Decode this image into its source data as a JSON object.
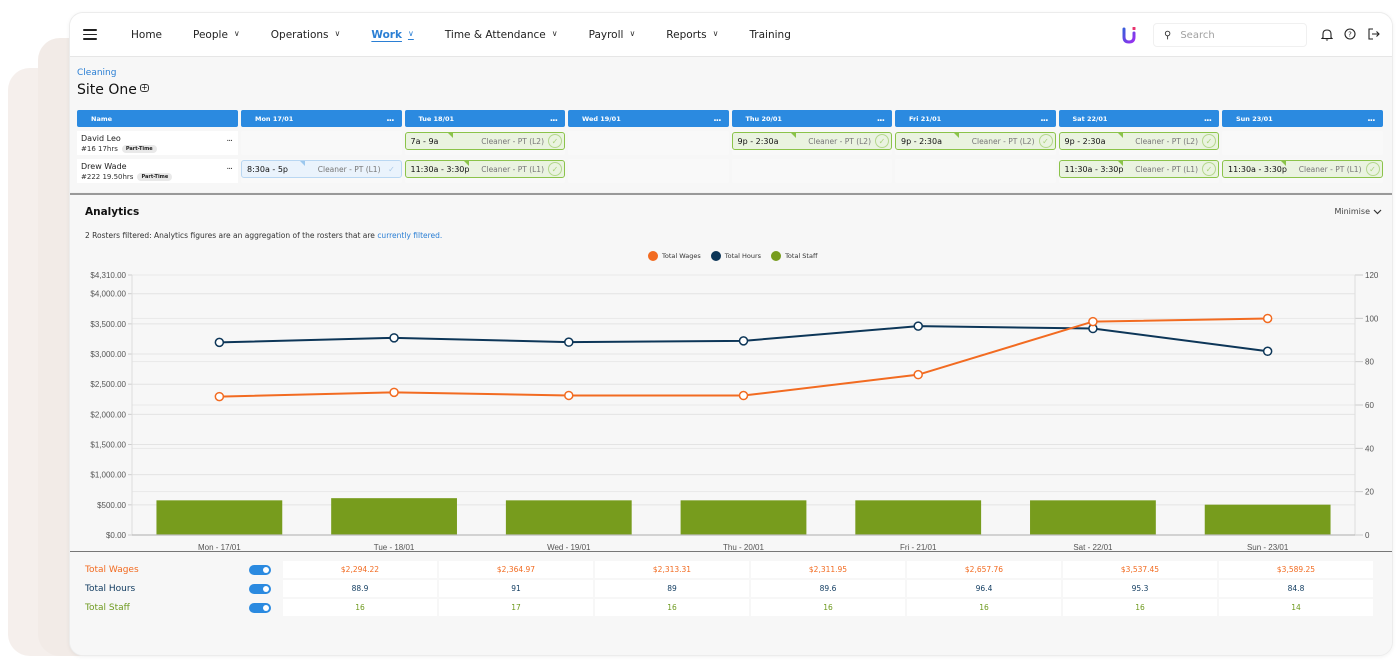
{
  "nav": {
    "items": [
      {
        "label": "Home",
        "dropdown": false,
        "active": false
      },
      {
        "label": "People",
        "dropdown": true,
        "active": false
      },
      {
        "label": "Operations",
        "dropdown": true,
        "active": false
      },
      {
        "label": "Work",
        "dropdown": true,
        "active": true
      },
      {
        "label": "Time & Attendance",
        "dropdown": true,
        "active": false
      },
      {
        "label": "Payroll",
        "dropdown": true,
        "active": false
      },
      {
        "label": "Reports",
        "dropdown": true,
        "active": false
      },
      {
        "label": "Training",
        "dropdown": false,
        "active": false
      }
    ],
    "search_placeholder": "Search",
    "icons": [
      "bell-icon",
      "help-icon",
      "logout-icon"
    ]
  },
  "roster": {
    "breadcrumb": "Cleaning",
    "title": "Site One",
    "name_header": "Name",
    "more_label": "...",
    "days": [
      "Mon 17/01",
      "Tue 18/01",
      "Wed 19/01",
      "Thu 20/01",
      "Fri 21/01",
      "Sat 22/01",
      "Sun 23/01"
    ],
    "employees": [
      {
        "name": "David Leo",
        "meta": "#16  17hrs",
        "badge": "Part-Time",
        "shifts": [
          null,
          {
            "time": "7a  -  9a",
            "role": "Cleaner - PT (L2)",
            "style": "green"
          },
          null,
          {
            "time": "9p  -  2:30a",
            "role": "Cleaner - PT (L2)",
            "style": "green"
          },
          {
            "time": "9p  -  2:30a",
            "role": "Cleaner - PT (L2)",
            "style": "green"
          },
          {
            "time": "9p  -  2:30a",
            "role": "Cleaner - PT (L2)",
            "style": "green"
          },
          null
        ]
      },
      {
        "name": "Drew Wade",
        "meta": "#222  19.50hrs",
        "badge": "Part-Time",
        "shifts": [
          {
            "time": "8:30a  -  5p",
            "role": "Cleaner - PT (L1)",
            "style": "blue"
          },
          {
            "time": "11:30a  -  3:30p",
            "role": "Cleaner - PT (L1)",
            "style": "green"
          },
          null,
          null,
          null,
          {
            "time": "11:30a  -  3:30p",
            "role": "Cleaner - PT (L1)",
            "style": "green"
          },
          {
            "time": "11:30a  -  3:30p",
            "role": "Cleaner - PT (L1)",
            "style": "green"
          }
        ]
      }
    ]
  },
  "analytics": {
    "title": "Analytics",
    "minimise_label": "Minimise",
    "description": "2 Rosters filtered: Analytics figures are an aggregation of the rosters that are ",
    "description_link": "currently filtered.",
    "summary": [
      {
        "label": "Total Wages",
        "enabled": true,
        "color": "#f26b21",
        "values": [
          "$2,294.22",
          "$2,364.97",
          "$2,313.31",
          "$2,311.95",
          "$2,657.76",
          "$3,537.45",
          "$3,589.25"
        ]
      },
      {
        "label": "Total Hours",
        "enabled": true,
        "color": "#0f3a5f",
        "values": [
          "88.9",
          "91",
          "89",
          "89.6",
          "96.4",
          "95.3",
          "84.8"
        ]
      },
      {
        "label": "Total Staff",
        "enabled": true,
        "color": "#6e9a1f",
        "values": [
          "16",
          "17",
          "16",
          "16",
          "16",
          "16",
          "14"
        ]
      }
    ]
  },
  "colors": {
    "wages": "#f26b21",
    "hours": "#0d3658",
    "staff": "#779c1d",
    "accent": "#2b8ae0"
  },
  "chart_data": {
    "type": "bar",
    "title": "",
    "categories": [
      "Mon - 17/01",
      "Tue - 18/01",
      "Wed - 19/01",
      "Thu - 20/01",
      "Fri - 21/01",
      "Sat - 22/01",
      "Sun - 23/01"
    ],
    "series": [
      {
        "name": "Total Wages",
        "type": "line",
        "axis": "left",
        "values": [
          2294.22,
          2364.97,
          2313.31,
          2311.95,
          2657.76,
          3537.45,
          3589.25
        ]
      },
      {
        "name": "Total Hours",
        "type": "line",
        "axis": "right",
        "values": [
          88.9,
          91,
          89,
          89.6,
          96.4,
          95.3,
          84.8
        ]
      },
      {
        "name": "Total Staff",
        "type": "bar",
        "axis": "right",
        "values": [
          16,
          17,
          16,
          16,
          16,
          16,
          14
        ]
      }
    ],
    "left_axis": {
      "ticks": [
        "$0.00",
        "$500.00",
        "$1,000.00",
        "$1,500.00",
        "$2,000.00",
        "$2,500.00",
        "$3,000.00",
        "$3,500.00",
        "$4,000.00",
        "$4,310.00"
      ],
      "tick_values": [
        0,
        500,
        1000,
        1500,
        2000,
        2500,
        3000,
        3500,
        4000,
        4310
      ],
      "ylim": [
        0,
        4310
      ]
    },
    "right_axis": {
      "ticks": [
        "0",
        "20",
        "40",
        "60",
        "80",
        "100",
        "120"
      ],
      "tick_values": [
        0,
        20,
        40,
        60,
        80,
        100,
        120
      ],
      "ylim": [
        0,
        120
      ]
    },
    "legend": [
      "Total Wages",
      "Total Hours",
      "Total Staff"
    ],
    "legend_position": "top-center",
    "grid": true
  }
}
